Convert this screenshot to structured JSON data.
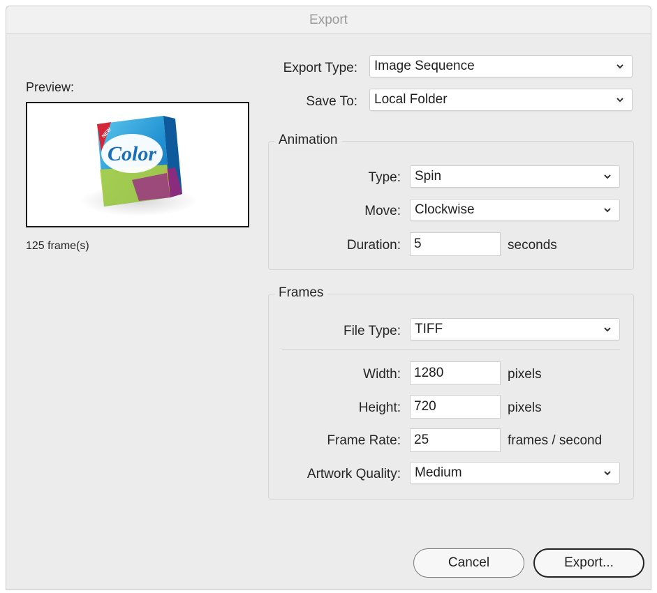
{
  "window": {
    "title": "Export"
  },
  "preview": {
    "label": "Preview:",
    "frames": "125 frame(s)"
  },
  "export_type": {
    "label": "Export Type:",
    "value": "Image Sequence"
  },
  "save_to": {
    "label": "Save To:",
    "value": "Local Folder"
  },
  "animation": {
    "title": "Animation",
    "type": {
      "label": "Type:",
      "value": "Spin"
    },
    "move": {
      "label": "Move:",
      "value": "Clockwise"
    },
    "duration": {
      "label": "Duration:",
      "value": "5",
      "unit": "seconds"
    }
  },
  "frames": {
    "title": "Frames",
    "file_type": {
      "label": "File Type:",
      "value": "TIFF"
    },
    "width": {
      "label": "Width:",
      "value": "1280",
      "unit": "pixels"
    },
    "height": {
      "label": "Height:",
      "value": "720",
      "unit": "pixels"
    },
    "frame_rate": {
      "label": "Frame Rate:",
      "value": "25",
      "unit": "frames / second"
    },
    "artwork_quality": {
      "label": "Artwork Quality:",
      "value": "Medium"
    }
  },
  "buttons": {
    "cancel": "Cancel",
    "export": "Export..."
  },
  "product": {
    "brand": "Color",
    "badge": "NEW"
  }
}
